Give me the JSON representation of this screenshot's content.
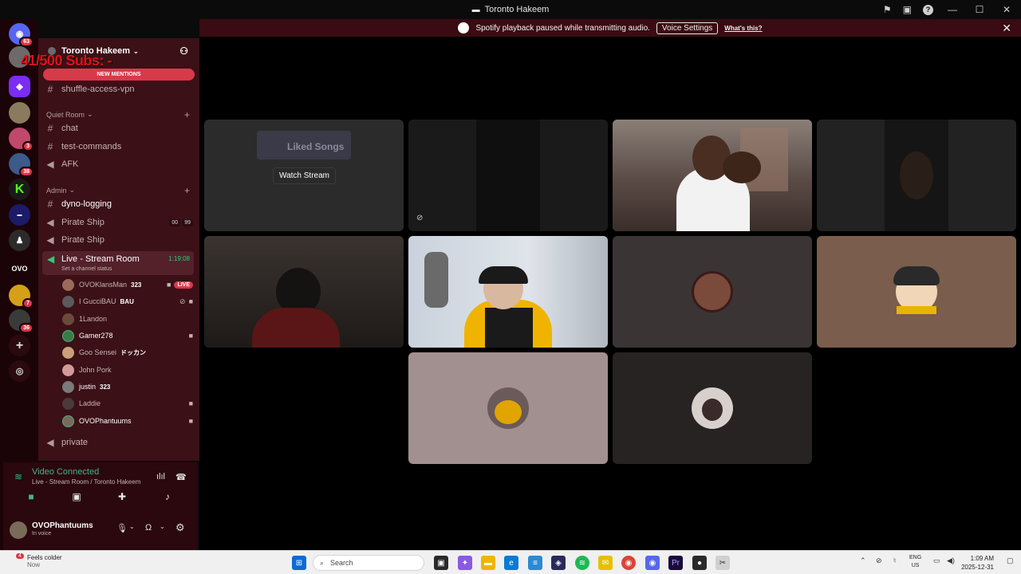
{
  "titlebar": {
    "title": "Toronto Hakeem"
  },
  "notice": {
    "text": "Spotify playback paused while transmitting audio.",
    "voice_settings": "Voice Settings",
    "whats_this": "What's this?"
  },
  "overlay": {
    "subs_text": "41/500 Subs: -"
  },
  "server_badges": {
    "home": "63",
    "s5": "3",
    "s6": "38",
    "s11": "7",
    "s12": "36"
  },
  "sidebar": {
    "server_name": "Toronto Hakeem",
    "new_mentions": "NEW MENTIONS",
    "channels": {
      "shuffle": "shuffle-access-vpn",
      "quiet_room": "Quiet Room",
      "chat": "chat",
      "test_commands": "test-commands",
      "afk": "AFK",
      "admin": "Admin",
      "dyno": "dyno-logging",
      "pirate1": "Pirate Ship",
      "pirate1_counts": [
        "00",
        "99"
      ],
      "pirate2": "Pirate Ship",
      "live_room": "Live - Stream Room",
      "live_timer": "1:19:08",
      "set_status": "Set a channel status",
      "private": "private"
    },
    "users": [
      {
        "name": "OVOKlansMan",
        "extra": "323",
        "live": "LIVE"
      },
      {
        "name": "I GucciBAU",
        "extra": "BAU"
      },
      {
        "name": "1Landon",
        "extra": ""
      },
      {
        "name": "Gamer278",
        "extra": ""
      },
      {
        "name": "Goo Sensei",
        "extra": "ドッカン"
      },
      {
        "name": "John Pork",
        "extra": ""
      },
      {
        "name": "justin",
        "extra": "323"
      },
      {
        "name": "Laddie",
        "extra": ""
      },
      {
        "name": "OVOPhantuums",
        "extra": ""
      }
    ]
  },
  "voice": {
    "status": "Video Connected",
    "location": "Live - Stream Room / Toronto Hakeem",
    "user_name": "OVOPhantuums",
    "user_status": "In voice"
  },
  "grid": {
    "watch_stream": "Watch Stream",
    "liked_songs": "Liked Songs"
  },
  "taskbar": {
    "weather": "Feels colder",
    "weather_time": "Now",
    "weather_badge": "4",
    "search": "Search",
    "lang1": "ENG",
    "lang2": "US",
    "time": "1:09 AM",
    "date": "2025-12-31"
  },
  "colors": {
    "accent_red": "#d83a4a",
    "voice_green": "#43b581",
    "sidebar_bg": "#3b1016"
  }
}
